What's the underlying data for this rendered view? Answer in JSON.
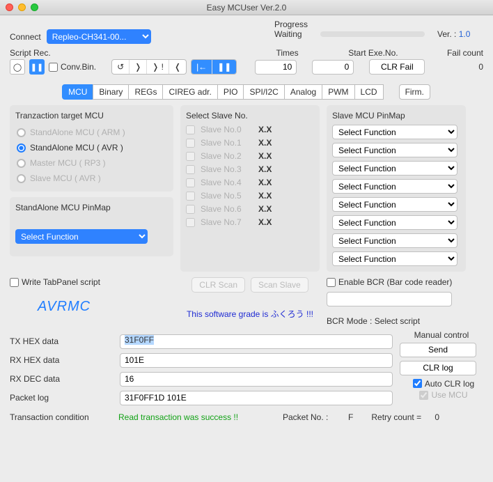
{
  "window": {
    "title": "Easy MCUser Ver.2.0"
  },
  "header": {
    "connect_label": "Connect",
    "connect_value": "Repleo-CH341-00...",
    "progress_label": "Progress",
    "progress_status": "Waiting",
    "ver_prefix": "Ver. : ",
    "ver_value": "1.0"
  },
  "script": {
    "label": "Script Rec.",
    "conv_bin": "Conv.Bin.",
    "times_label": "Times",
    "times_value": "10",
    "start_label": "Start Exe.No.",
    "start_value": "0",
    "clr_fail": "CLR Fail",
    "fail_label": "Fail count",
    "fail_value": "0"
  },
  "tabs": [
    "MCU",
    "Binary",
    "REGs",
    "CIREG adr.",
    "PIO",
    "SPI/I2C",
    "Analog",
    "PWM",
    "LCD",
    "Firm."
  ],
  "group_target": {
    "title": "Tranzaction target MCU",
    "items": [
      "StandAlone MCU ( ARM )",
      "StandAlone MCU ( AVR )",
      "Master MCU ( RP3 )",
      "Slave MCU ( AVR )"
    ],
    "selected": 1
  },
  "group_pinmap": {
    "title": "StandAlone MCU PinMap",
    "select": "Select Function"
  },
  "group_slave": {
    "title": "Select Slave No.",
    "items": [
      "Slave No.0",
      "Slave No.1",
      "Slave No.2",
      "Slave No.3",
      "Slave No.4",
      "Slave No.5",
      "Slave No.6",
      "Slave No.7"
    ],
    "xx": "X.X",
    "clr_scan": "CLR Scan",
    "scan_slave": "Scan Slave"
  },
  "group_slave_pin": {
    "title": "Slave MCU PinMap",
    "select": "Select Function"
  },
  "below": {
    "write_tab": "Write TabPanel script",
    "avrmc": "AVRMC",
    "grade": "This software grade is ふくろう !!!",
    "enable_bcr": "Enable BCR (Bar code reader)",
    "bcr_mode": "BCR Mode : Select script"
  },
  "data": {
    "tx_label": "TX HEX data",
    "tx_value": "31F0FF",
    "rx_label": "RX HEX data",
    "rx_value": "101E",
    "rxd_label": "RX DEC data",
    "rxd_value": "16",
    "pkt_label": "Packet log",
    "pkt_value": "31F0FF1D 101E"
  },
  "manual": {
    "title": "Manual control",
    "send": "Send",
    "clr_log": "CLR log",
    "auto_clr": "Auto CLR log",
    "use_mcu": "Use MCU"
  },
  "status": {
    "cond_label": "Transaction condition",
    "cond_value": "Read transaction was success !!",
    "packet_label": "Packet No. :",
    "packet_value": "F",
    "retry_label": "Retry count  =",
    "retry_value": "0"
  }
}
